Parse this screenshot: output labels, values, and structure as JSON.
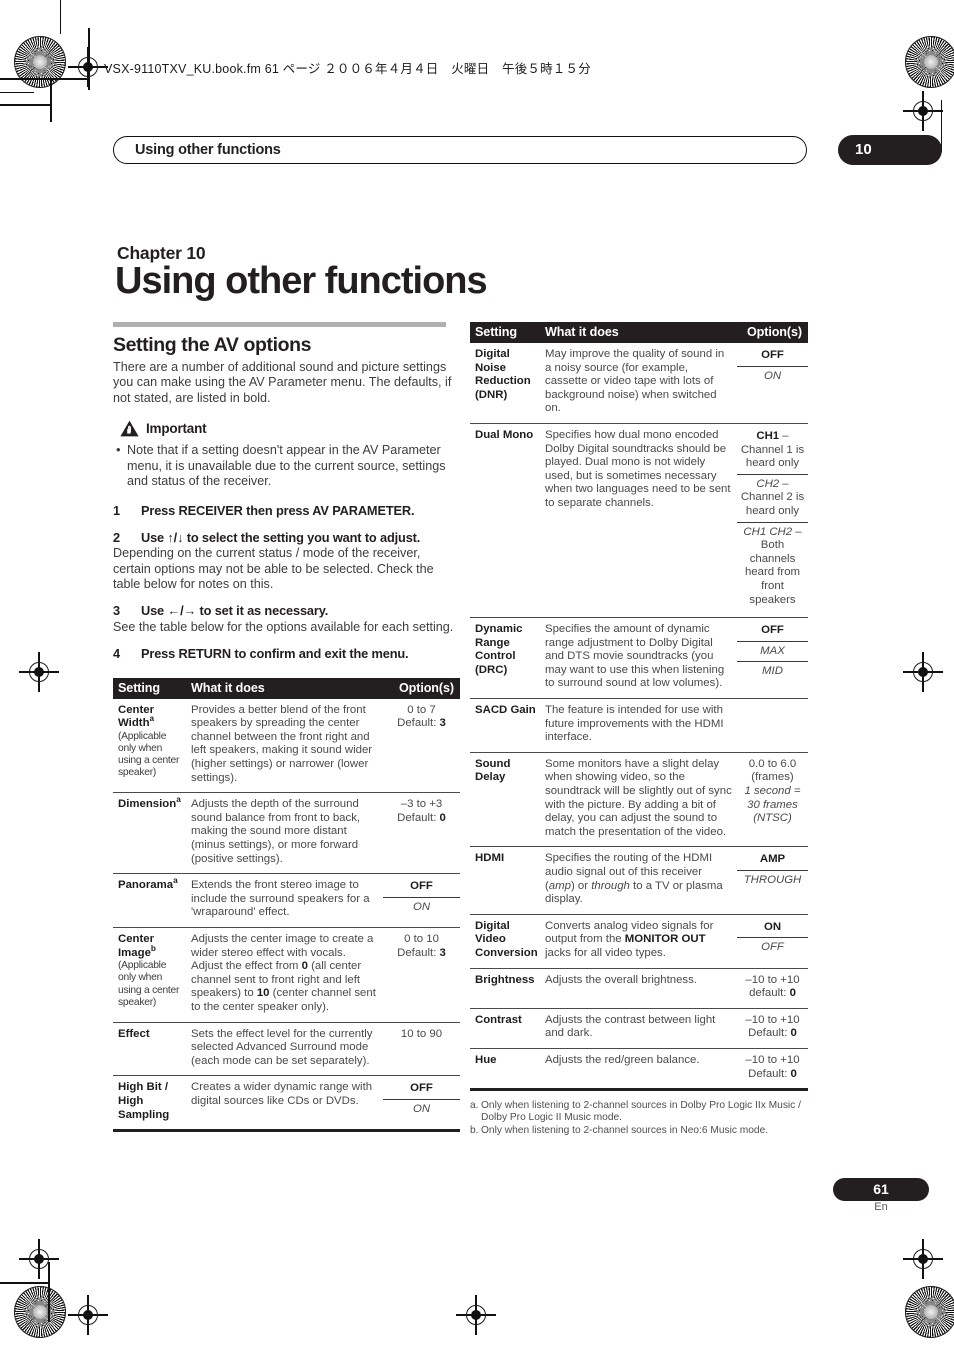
{
  "slug": "VSX-9110TXV_KU.book.fm  61 ページ  ２００６年４月４日　火曜日　午後５時１５分",
  "running_header": "Using other functions",
  "chapter_badge": "10",
  "chapter_label": "Chapter 10",
  "chapter_title": "Using other functions",
  "section": {
    "title": "Setting the AV options",
    "intro": "There are a number of additional sound and picture settings you can make using the AV Parameter menu. The defaults, if not stated, are listed in bold.",
    "important_label": "Important",
    "important_bullets": [
      "Note that if a setting doesn't appear in the AV Parameter menu, it is unavailable due to the current source, settings and status of the receiver."
    ]
  },
  "steps": [
    {
      "num": "1",
      "text": "Press RECEIVER then press AV PARAMETER.",
      "sub": ""
    },
    {
      "num": "2",
      "text": "Use ↑/↓ to select the setting you want to adjust.",
      "sub": "Depending on the current status / mode of the receiver, certain options may not be able to be selected. Check the table below for notes on this."
    },
    {
      "num": "3",
      "text": "Use ←/→ to set it as necessary.",
      "sub": "See the table below for the options available for each setting."
    },
    {
      "num": "4",
      "text": "Press RETURN to confirm and exit the menu.",
      "sub": ""
    }
  ],
  "table_headers": {
    "setting": "Setting",
    "what": "What it does",
    "options": "Option(s)"
  },
  "left_table": [
    {
      "setting": "Center Width",
      "note_ref": "a",
      "qualifier": "(Applicable only when using a center speaker)",
      "desc": "Provides a better blend of the front speakers by spreading the center channel between the front right and left speakers, making it sound wider (higher settings) or narrower (lower settings).",
      "options_plain": "0 to 7",
      "default_label": "Default:",
      "default_value": "3"
    },
    {
      "setting": "Dimension",
      "note_ref": "a",
      "qualifier": "",
      "desc": "Adjusts the depth of the surround sound balance from front to back, making the sound more distant (minus settings), or more forward (positive settings).",
      "options_plain": "–3 to +3",
      "default_label": "Default:",
      "default_value": "0"
    },
    {
      "setting": "Panorama",
      "note_ref": "a",
      "qualifier": "",
      "desc": "Extends the front stereo image to include the surround speakers for a 'wraparound' effect.",
      "option_stack": [
        {
          "text": "OFF",
          "style": "bold"
        },
        {
          "text": "ON",
          "style": "italic"
        }
      ]
    },
    {
      "setting": "Center Image",
      "note_ref": "b",
      "qualifier": "(Applicable only when using a center speaker)",
      "desc_parts": [
        {
          "t": "Adjusts the center image to create a wider stereo effect with vocals. Adjust the effect from ",
          "b": false
        },
        {
          "t": "0",
          "b": true
        },
        {
          "t": " (all center channel sent to front right and left speakers) to ",
          "b": false
        },
        {
          "t": "10",
          "b": true
        },
        {
          "t": " (center channel sent to the center speaker only).",
          "b": false
        }
      ],
      "options_plain": "0 to 10",
      "default_label": "Default:",
      "default_value": "3"
    },
    {
      "setting": "Effect",
      "note_ref": "",
      "qualifier": "",
      "desc": "Sets the effect level for the currently selected Advanced Surround mode (each mode can be set separately).",
      "options_plain": "10 to 90"
    },
    {
      "setting": "High Bit / High Sampling",
      "note_ref": "",
      "qualifier": "",
      "desc": "Creates a wider dynamic range with digital sources like CDs or DVDs.",
      "option_stack": [
        {
          "text": "OFF",
          "style": "bold"
        },
        {
          "text": "ON",
          "style": "italic"
        }
      ]
    }
  ],
  "right_table": [
    {
      "setting": "Digital Noise Reduction (DNR)",
      "desc": "May improve the quality of sound in a noisy source (for example, cassette or video tape with lots of background noise) when switched on.",
      "option_stack": [
        {
          "text": "OFF",
          "style": "bold"
        },
        {
          "text": "ON",
          "style": "italic"
        }
      ]
    },
    {
      "setting": "Dual Mono",
      "desc": "Specifies how dual mono encoded Dolby Digital soundtracks should be played. Dual mono is not widely used, but is sometimes necessary when two languages need to be sent to separate channels.",
      "option_stack": [
        {
          "lead": "CH1",
          "lead_style": "bold",
          "text": " – Channel 1 is heard only",
          "style": "plain"
        },
        {
          "lead": "CH2",
          "lead_style": "italic",
          "text": " – Channel 2 is heard only",
          "style": "plain"
        },
        {
          "lead": "CH1 CH2",
          "lead_style": "italic",
          "text": " – Both channels heard from front speakers",
          "style": "plain"
        }
      ]
    },
    {
      "setting": "Dynamic Range Control (DRC)",
      "desc": "Specifies the amount of dynamic range adjustment to Dolby Digital and DTS movie soundtracks (you may want to use this when listening to surround sound at low volumes).",
      "option_stack": [
        {
          "text": "OFF",
          "style": "bold"
        },
        {
          "text": "MAX",
          "style": "italic"
        },
        {
          "text": "MID",
          "style": "italic"
        }
      ]
    },
    {
      "setting": "SACD Gain",
      "desc": "The feature is intended for use with future improvements with the HDMI interface.",
      "option_stack": []
    },
    {
      "setting": "Sound Delay",
      "desc": "Some monitors have a slight delay when showing video, so the soundtrack will be slightly out of sync with the picture. By adding a bit of delay, you can adjust the sound to match the presentation of the video.",
      "options_plain": "0.0 to 6.0 (frames)",
      "options_italic": "1 second = 30 frames (NTSC)"
    },
    {
      "setting": "HDMI",
      "desc_parts": [
        {
          "t": "Specifies the routing of the HDMI audio signal out of this receiver (",
          "s": "plain"
        },
        {
          "t": "amp",
          "s": "italic"
        },
        {
          "t": ") or ",
          "s": "plain"
        },
        {
          "t": "through",
          "s": "italic"
        },
        {
          "t": " to a TV or plasma display.",
          "s": "plain"
        }
      ],
      "option_stack": [
        {
          "text": "AMP",
          "style": "bold"
        },
        {
          "text": "THROUGH",
          "style": "italic"
        }
      ]
    },
    {
      "setting": "Digital Video Conversion",
      "desc_parts": [
        {
          "t": "Converts analog video signals for output from the ",
          "s": "plain"
        },
        {
          "t": "MONITOR OUT",
          "s": "bold"
        },
        {
          "t": " jacks for all video types.",
          "s": "plain"
        }
      ],
      "option_stack": [
        {
          "text": "ON",
          "style": "bold"
        },
        {
          "text": "OFF",
          "style": "italic"
        }
      ]
    },
    {
      "setting": "Brightness",
      "desc": "Adjusts the overall brightness.",
      "options_plain": "–10 to +10",
      "default_label": "default:",
      "default_value": "0"
    },
    {
      "setting": "Contrast",
      "desc": "Adjusts the contrast between light and dark.",
      "options_plain": "–10 to +10",
      "default_label": "Default:",
      "default_value": "0"
    },
    {
      "setting": "Hue",
      "desc": "Adjusts the red/green balance.",
      "options_plain": "–10 to +10",
      "default_label": "Default:",
      "default_value": "0"
    }
  ],
  "footnotes": [
    {
      "key": "a.",
      "text": "Only when listening to 2-channel sources in Dolby Pro Logic IIx Music / Dolby Pro Logic II Music mode."
    },
    {
      "key": "b.",
      "text": "Only when listening to 2-channel sources in Neo:6 Music mode."
    }
  ],
  "footer": {
    "page_number": "61",
    "language": "En"
  }
}
